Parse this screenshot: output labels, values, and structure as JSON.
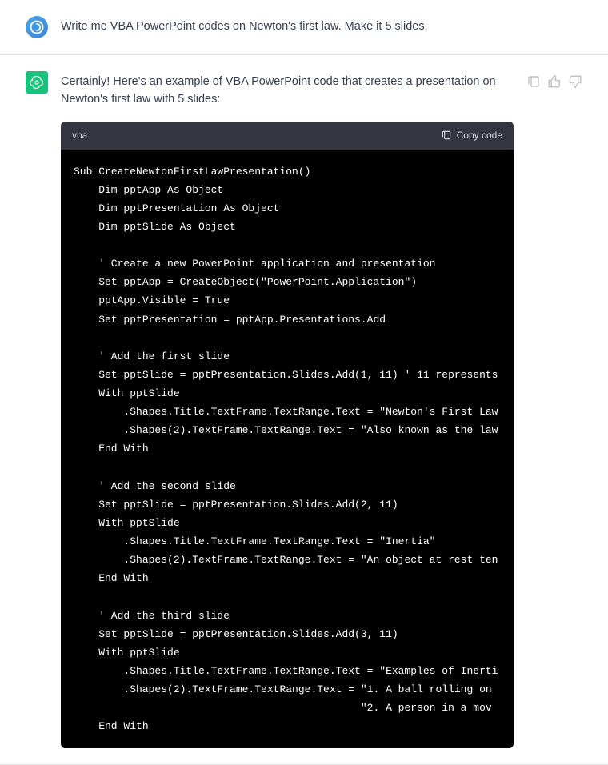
{
  "user": {
    "message": "Write me VBA PowerPoint codes on Newton's first law. Make it 5 slides."
  },
  "assistant": {
    "intro": "Certainly! Here's an example of VBA PowerPoint code that creates a presentation on Newton's first law with 5 slides:",
    "code_lang": "vba",
    "copy_label": "Copy code",
    "code": "Sub CreateNewtonFirstLawPresentation()\n    Dim pptApp As Object\n    Dim pptPresentation As Object\n    Dim pptSlide As Object\n    \n    ' Create a new PowerPoint application and presentation\n    Set pptApp = CreateObject(\"PowerPoint.Application\")\n    pptApp.Visible = True\n    Set pptPresentation = pptApp.Presentations.Add\n    \n    ' Add the first slide\n    Set pptSlide = pptPresentation.Slides.Add(1, 11) ' 11 represents\n    With pptSlide\n        .Shapes.Title.TextFrame.TextRange.Text = \"Newton's First Law\n        .Shapes(2).TextFrame.TextRange.Text = \"Also known as the law\n    End With\n    \n    ' Add the second slide\n    Set pptSlide = pptPresentation.Slides.Add(2, 11)\n    With pptSlide\n        .Shapes.Title.TextFrame.TextRange.Text = \"Inertia\"\n        .Shapes(2).TextFrame.TextRange.Text = \"An object at rest ten\n    End With\n    \n    ' Add the third slide\n    Set pptSlide = pptPresentation.Slides.Add(3, 11)\n    With pptSlide\n        .Shapes.Title.TextFrame.TextRange.Text = \"Examples of Inerti\n        .Shapes(2).TextFrame.TextRange.Text = \"1. A ball rolling on \n                                              \"2. A person in a mov\n    End With"
  }
}
